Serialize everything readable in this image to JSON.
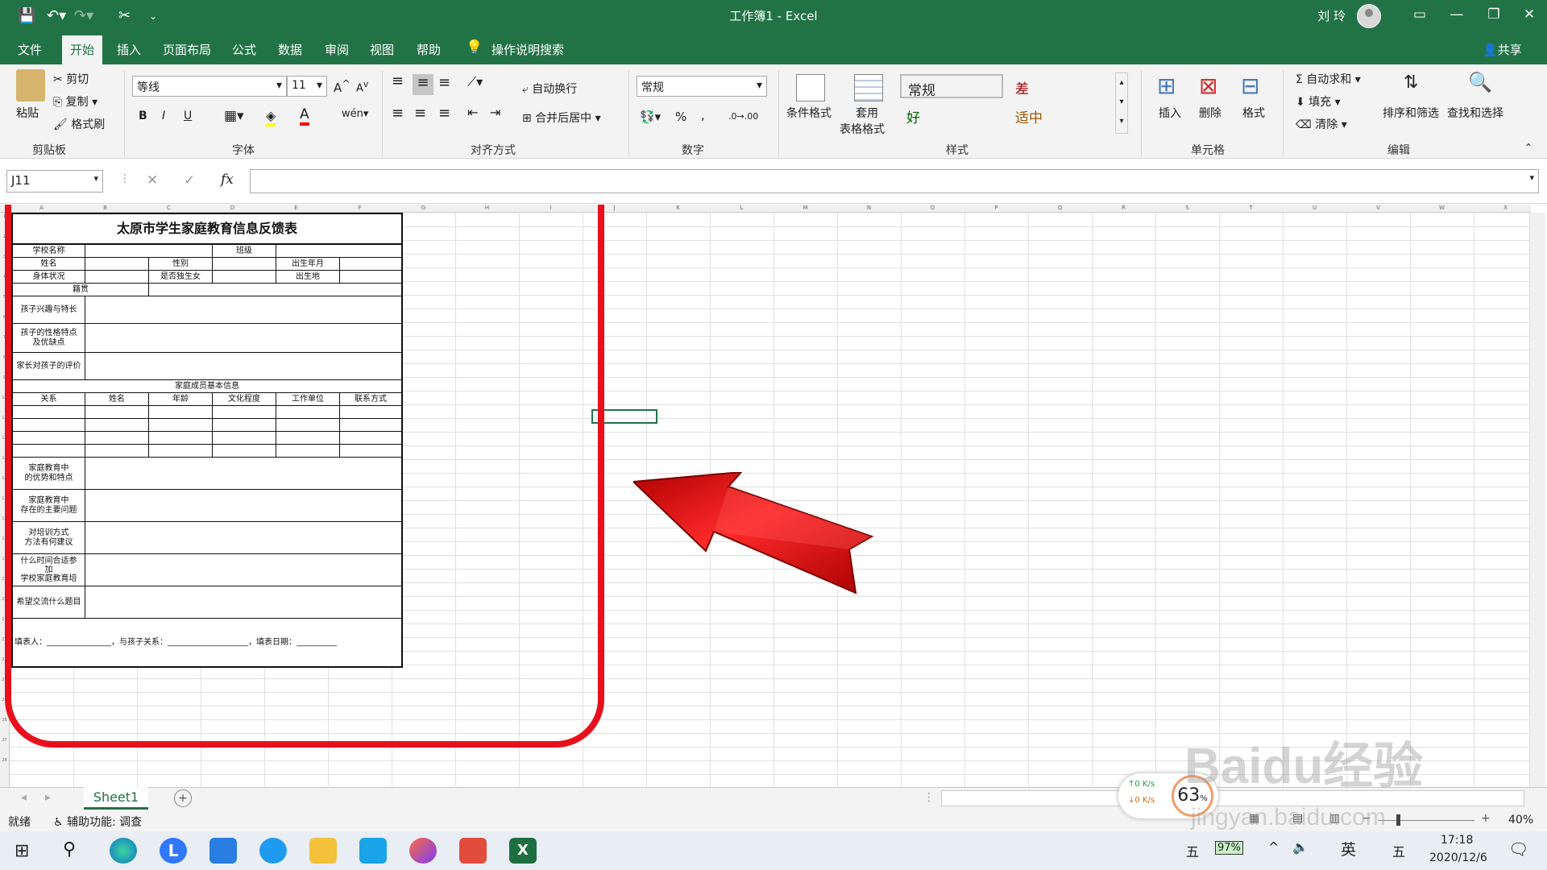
{
  "window": {
    "title": "工作簿1  -  Excel",
    "user": "刘 玲"
  },
  "menu": {
    "tabs": [
      "文件",
      "开始",
      "插入",
      "页面布局",
      "公式",
      "数据",
      "审阅",
      "视图",
      "帮助"
    ],
    "active": "开始",
    "search": "操作说明搜索",
    "share": "共享"
  },
  "ribbon": {
    "clipboard": {
      "paste": "粘贴",
      "cut": "剪切",
      "copy": "复制",
      "painter": "格式刷",
      "label": "剪贴板"
    },
    "font": {
      "name": "等线",
      "size": "11",
      "label": "字体",
      "bold": "B",
      "italic": "I",
      "underline": "U"
    },
    "align": {
      "wrap": "自动换行",
      "merge": "合并后居中",
      "label": "对齐方式"
    },
    "number": {
      "format": "常规",
      "percent": "%",
      "comma": ",",
      "label": "数字"
    },
    "styles": {
      "conditional": "条件格式",
      "table1": "套用",
      "table2": "表格格式",
      "normal": "常规",
      "bad": "差",
      "good": "好",
      "neutral": "适中",
      "label": "样式"
    },
    "cells": {
      "insert": "插入",
      "delete": "删除",
      "format": "格式",
      "label": "单元格"
    },
    "editing": {
      "autosum": "自动求和",
      "fill": "填充",
      "clear": "清除",
      "sort": "排序和筛选",
      "find": "查找和选择",
      "label": "编辑"
    },
    "colors": {
      "normal": "#ffffff",
      "bad": "#ffc7ce",
      "good": "#c6efce",
      "neutral": "#ffeb9c"
    }
  },
  "formula": {
    "namebox": "J11",
    "fx": "fx",
    "cancel": "✕",
    "confirm": "✓"
  },
  "grid": {
    "columns": [
      "A",
      "B",
      "C",
      "D",
      "E",
      "F",
      "G",
      "H",
      "I",
      "J",
      "K",
      "L",
      "M",
      "N",
      "O",
      "P",
      "Q",
      "R",
      "S",
      "T",
      "U",
      "V",
      "W",
      "X"
    ],
    "rows": [
      "1",
      "2",
      "3",
      "4",
      "5",
      "6",
      "7",
      "8",
      "9",
      "10",
      "11",
      "12",
      "13",
      "14",
      "15",
      "16",
      "17",
      "18",
      "19",
      "20",
      "21",
      "22",
      "23",
      "24",
      "25",
      "26",
      "27",
      "28"
    ]
  },
  "form": {
    "title": "太原市学生家庭教育信息反馈表",
    "school": "学校名称",
    "class": "班级",
    "name": "姓名",
    "gender": "性别",
    "birth": "出生年月",
    "health": "身体状况",
    "only": "是否独生女",
    "birthplace": "出生地",
    "origin": "籍贯",
    "hobby": "孩子兴趣与特长",
    "character": "孩子的性格特点\n及优缺点",
    "evaluation": "家长对孩子的评价",
    "family_title": "家庭成员基本信息",
    "family_headers": [
      "关系",
      "姓名",
      "年龄",
      "文化程度",
      "工作单位",
      "联系方式"
    ],
    "adv": "家庭教育中\n的优势和特点",
    "problems": "家庭教育中\n存在的主要问题",
    "suggest": "对培训方式\n方法有何建议",
    "when": "什么时间合适参\n加\n学校家庭教育培",
    "topics": "希望交流什么题目",
    "footer": "填表人：________________，与孩子关系：____________________，填表日期：__________"
  },
  "sheets": {
    "active": "Sheet1",
    "add": "+"
  },
  "status": {
    "ready": "就绪",
    "access": "辅助功能: 调查",
    "zoom": "40%",
    "zoom_minus": "−",
    "zoom_plus": "+"
  },
  "speed": {
    "up": "0  K/s",
    "down": "0  K/s",
    "percent": "63",
    "unit": "%"
  },
  "watermark": {
    "main": "Baidu经验",
    "sub": "jingyan.baidu.com"
  },
  "taskbar": {
    "time": "17:18",
    "date": "2020/12/6",
    "ime": "英",
    "ime2": "五",
    "battery": "97%"
  },
  "annotation": {
    "circle_color": "#e8101c",
    "arrow_color": "#e60012"
  }
}
